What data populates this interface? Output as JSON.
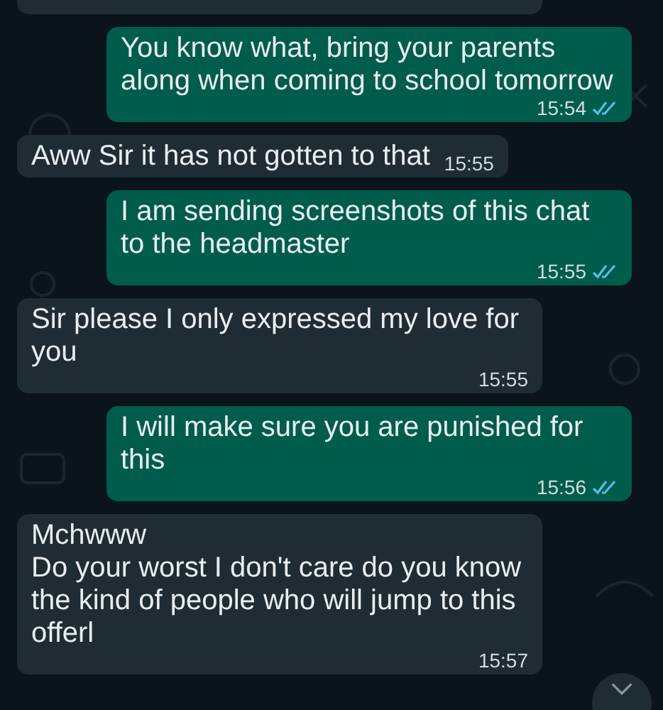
{
  "messages": [
    {
      "kind": "partial"
    },
    {
      "kind": "sent",
      "text": "You know what, bring your parents along when coming to school tomorrow",
      "time": "15:54",
      "read": true
    },
    {
      "kind": "received",
      "text": "Aww Sir it has not gotten to that",
      "time": "15:55"
    },
    {
      "kind": "sent",
      "text": "I am sending screenshots of this chat to the headmaster",
      "time": "15:55",
      "read": true
    },
    {
      "kind": "received",
      "text": "Sir please I only expressed my love for you",
      "time": "15:55"
    },
    {
      "kind": "sent",
      "text": "I will make sure you are punished for this",
      "time": "15:56",
      "read": true
    },
    {
      "kind": "received",
      "text": "Mchwww\nDo your worst I don't care do you know the kind of people who will jump to this offerl",
      "time": "15:57"
    }
  ]
}
